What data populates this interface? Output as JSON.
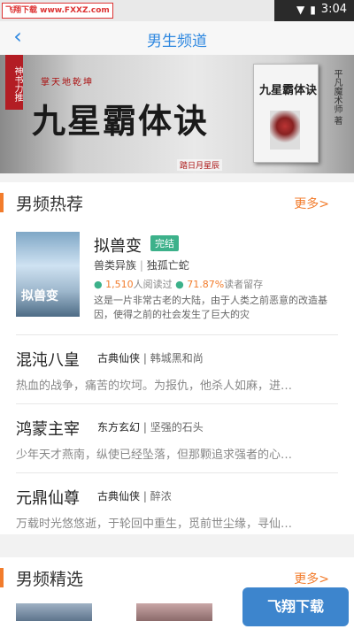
{
  "status_bar": {
    "watermark": "飞翔下载 www.FXXZ.com",
    "time": "3:04"
  },
  "header": {
    "title": "男生频道"
  },
  "banner": {
    "ribbon": "神书力推",
    "subtitle": "掌天地乾坤",
    "title": "九星霸体诀",
    "tagline": "踏日月星辰",
    "book_cover_title": "九星霸体诀",
    "author": "平凡魔术师 著"
  },
  "recommend": {
    "title": "男频热荐",
    "more": "更多>",
    "featured": {
      "title": "拟兽变",
      "badge": "完结",
      "cover_title": "拟兽变",
      "category": "兽类异族",
      "author": "独孤亡蛇",
      "readers": "1,510",
      "readers_suffix": "人阅读过",
      "retention": "71.87%",
      "retention_suffix": "读者留存",
      "desc": "这是一片非常古老的大陆，由于人类之前恶意的改造基因，使得之前的社会发生了巨大的灾"
    },
    "rows": [
      {
        "title": "混沌八皇",
        "category": "古典仙侠",
        "author": "韩城黑和尚",
        "desc": "热血的战争，痛苦的坎坷。为报仇，他杀人如麻，进…"
      },
      {
        "title": "鸿蒙主宰",
        "category": "东方玄幻",
        "author": "坚强的石头",
        "desc": "少年天才燕南，纵使已经坠落，但那颗追求强者的心…"
      },
      {
        "title": "元鼎仙尊",
        "category": "古典仙侠",
        "author": "醉浓",
        "desc": "万载时光悠悠逝，于轮回中重生，觅前世尘缘，寻仙…"
      }
    ]
  },
  "selected": {
    "title": "男频精选",
    "more": "更多>"
  },
  "bottom_watermark": "飞翔下载"
}
